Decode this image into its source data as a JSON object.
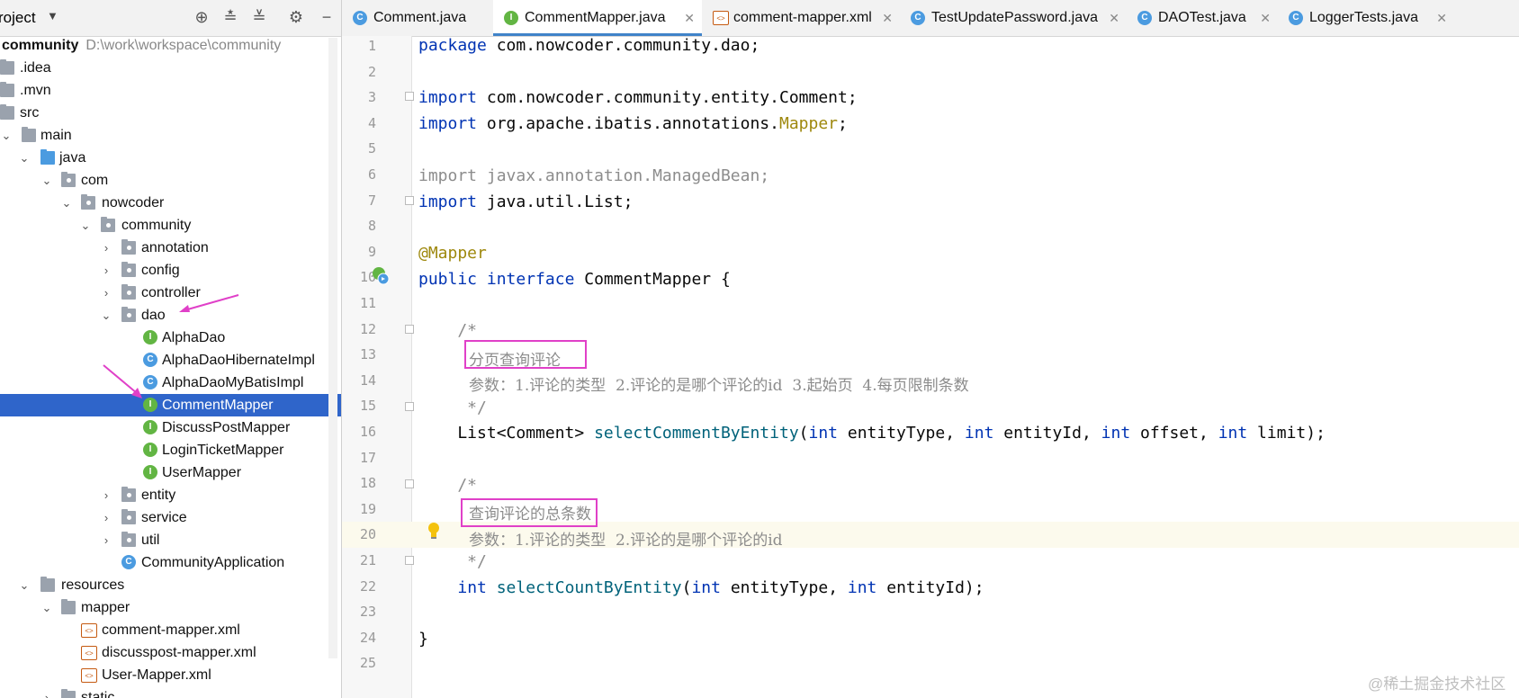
{
  "project": {
    "title": "Project",
    "title_visible": "roject",
    "root_name": "community",
    "root_path": "D:\\work\\workspace\\community",
    "tree": [
      {
        "label": "community",
        "path": "D:\\work\\workspace\\community",
        "type": "root"
      },
      {
        "label": ".idea",
        "type": "folder"
      },
      {
        "label": ".mvn",
        "type": "folder"
      },
      {
        "label": "src",
        "type": "folder"
      },
      {
        "label": "main",
        "type": "folder"
      },
      {
        "label": "java",
        "type": "source-folder"
      },
      {
        "label": "com",
        "type": "package"
      },
      {
        "label": "nowcoder",
        "type": "package"
      },
      {
        "label": "community",
        "type": "package"
      },
      {
        "label": "annotation",
        "type": "package"
      },
      {
        "label": "config",
        "type": "package"
      },
      {
        "label": "controller",
        "type": "package"
      },
      {
        "label": "dao",
        "type": "package"
      },
      {
        "label": "AlphaDao",
        "type": "interface"
      },
      {
        "label": "AlphaDaoHibernateImpl",
        "type": "class"
      },
      {
        "label": "AlphaDaoMyBatisImpl",
        "type": "class"
      },
      {
        "label": "CommentMapper",
        "type": "interface",
        "selected": true
      },
      {
        "label": "DiscussPostMapper",
        "type": "interface"
      },
      {
        "label": "LoginTicketMapper",
        "type": "interface"
      },
      {
        "label": "UserMapper",
        "type": "interface"
      },
      {
        "label": "entity",
        "type": "package"
      },
      {
        "label": "service",
        "type": "package"
      },
      {
        "label": "util",
        "type": "package"
      },
      {
        "label": "CommunityApplication",
        "type": "class"
      },
      {
        "label": "resources",
        "type": "folder"
      },
      {
        "label": "mapper",
        "type": "folder"
      },
      {
        "label": "comment-mapper.xml",
        "type": "xml"
      },
      {
        "label": "discusspost-mapper.xml",
        "type": "xml"
      },
      {
        "label": "User-Mapper.xml",
        "type": "xml"
      },
      {
        "label": "static",
        "type": "folder"
      }
    ]
  },
  "tabs": [
    {
      "label": "Comment.java",
      "icon": "class-icon",
      "active": false,
      "closable": false
    },
    {
      "label": "CommentMapper.java",
      "icon": "interface-icon",
      "active": true,
      "closable": true
    },
    {
      "label": "comment-mapper.xml",
      "icon": "xml-icon",
      "active": false,
      "closable": true
    },
    {
      "label": "TestUpdatePassword.java",
      "icon": "test-class-icon",
      "active": false,
      "closable": true
    },
    {
      "label": "DAOTest.java",
      "icon": "test-class-icon",
      "active": false,
      "closable": true
    },
    {
      "label": "LoggerTests.java",
      "icon": "test-class-icon",
      "active": false,
      "closable": true
    }
  ],
  "editor": {
    "line_numbers": [
      "1",
      "2",
      "3",
      "4",
      "5",
      "6",
      "7",
      "8",
      "9",
      "10",
      "11",
      "12",
      "13",
      "14",
      "15",
      "16",
      "17",
      "18",
      "19",
      "20",
      "21",
      "22",
      "23",
      "24",
      "25"
    ],
    "lines": {
      "l1a": "package",
      "l1b": " com.nowcoder.community.dao;",
      "l3a": "import",
      "l3b": " com.nowcoder.community.entity.Comment;",
      "l4a": "import",
      "l4b": " org.apache.ibatis.annotations.",
      "l4c": "Mapper",
      "l4d": ";",
      "l6": "import javax.annotation.ManagedBean;",
      "l7a": "import",
      "l7b": " java.util.List;",
      "l9": "@Mapper",
      "l10a": "public",
      "l10b": " ",
      "l10c": "interface",
      "l10d": " CommentMapper {",
      "l12": "    /*",
      "l13": "分页查询评论",
      "l14": "参数：1.评论的类型  2.评论的是哪个评论的id  3.起始页  4.每页限制条数",
      "l15": "     */",
      "l16a": "    List<Comment> ",
      "l16b": "selectCommentByEntity",
      "l16c": "(",
      "l16d": "int",
      "l16e": " entityType, ",
      "l16f": "int",
      "l16g": " entityId, ",
      "l16h": "int",
      "l16i": " offset, ",
      "l16j": "int",
      "l16k": " limit);",
      "l18": "    /*",
      "l19": "查询评论的总条数",
      "l20": "参数：1.评论的类型  2.评论的是哪个评论的id",
      "l21": "     */",
      "l22a": "    ",
      "l22b": "int",
      "l22c": " ",
      "l22d": "selectCountByEntity",
      "l22e": "(",
      "l22f": "int",
      "l22g": " entityType, ",
      "l22h": "int",
      "l22i": " entityId);",
      "l24": "}"
    }
  },
  "watermark": "@稀土掘金技术社区",
  "colors": {
    "keyword": "#0033b3",
    "annotation": "#9e880d",
    "method": "#00627a",
    "comment": "#8c8c8c",
    "selection": "#2f65ca",
    "highlight_box": "#e040c8"
  }
}
